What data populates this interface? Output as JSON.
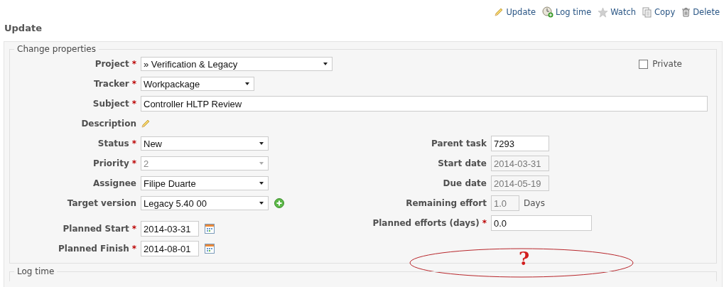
{
  "actions": [
    {
      "kind": "edit",
      "label": "Update"
    },
    {
      "kind": "time",
      "label": "Log time"
    },
    {
      "kind": "watch",
      "label": "Watch"
    },
    {
      "kind": "copy",
      "label": "Copy"
    },
    {
      "kind": "delete",
      "label": "Delete"
    }
  ],
  "heading": "Update",
  "change_properties": {
    "legend": "Change properties",
    "private": {
      "label": "Private",
      "checked": false
    },
    "top_fields": [
      {
        "kind": "select",
        "label": "Project",
        "required_mark": "*",
        "disabled": false,
        "value": "» Verification & Legacy"
      },
      {
        "kind": "select",
        "label": "Tracker",
        "required_mark": "*",
        "disabled": false,
        "value": "Workpackage"
      },
      {
        "kind": "text",
        "label": "Subject",
        "required_mark": "*",
        "disabled": false,
        "value": "Controller HLTP Review"
      },
      {
        "kind": "edit",
        "label": "Description",
        "disabled": false
      }
    ],
    "left_fields": [
      {
        "kind": "select",
        "label": "Status",
        "required_mark": "*",
        "disabled": false,
        "value": "New"
      },
      {
        "kind": "select",
        "label": "Priority",
        "required_mark": "*",
        "disabled": true,
        "value": "2"
      },
      {
        "kind": "select",
        "label": "Assignee",
        "disabled": false,
        "value": "Filipe Duarte"
      },
      {
        "kind": "select_add",
        "label": "Target version",
        "disabled": false,
        "value": "Legacy 5.40 00"
      },
      {
        "kind": "date",
        "label": "Planned Start",
        "required_mark": "*",
        "disabled": false,
        "value": "2014-03-31"
      },
      {
        "kind": "date",
        "label": "Planned Finish",
        "required_mark": "*",
        "disabled": false,
        "value": "2014-08-01"
      }
    ],
    "right_fields": [
      {
        "kind": "text",
        "label": "Parent task",
        "disabled": false,
        "value": "7293"
      },
      {
        "kind": "text",
        "label": "Start date",
        "disabled": true,
        "value": "2014-03-31"
      },
      {
        "kind": "text",
        "label": "Due date",
        "disabled": true,
        "value": "2014-05-19"
      },
      {
        "kind": "unit",
        "label": "Remaining effort",
        "disabled": true,
        "value": "1.0",
        "unit": "Days"
      },
      {
        "kind": "text",
        "label": "Planned efforts (days)",
        "required_mark": "*",
        "disabled": false,
        "value": "0.0"
      }
    ],
    "annotation": {
      "mark": "?"
    }
  },
  "log_time": {
    "legend": "Log time"
  }
}
